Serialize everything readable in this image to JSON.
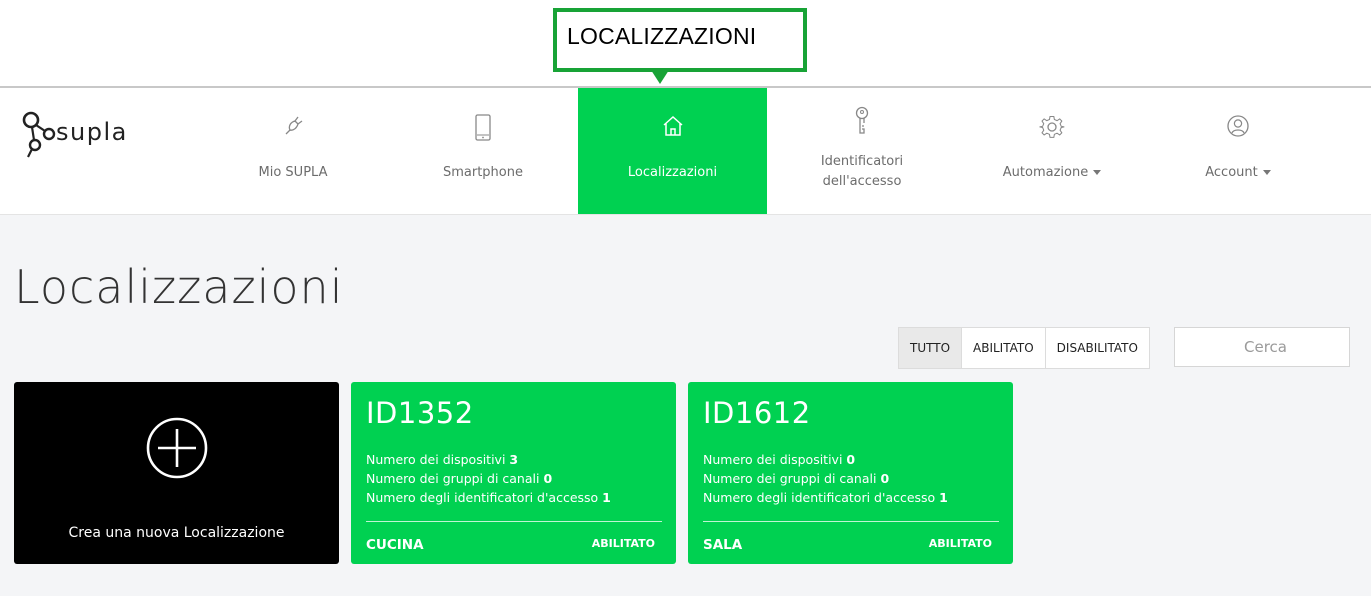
{
  "callout": {
    "text": "LOCALIZZAZIONI",
    "border_color": "#18a336"
  },
  "logo": {
    "text": "supla"
  },
  "nav": {
    "mio_supla": "Mio SUPLA",
    "smartphone": "Smartphone",
    "localizzazioni": "Localizzazioni",
    "access_line1": "Identificatori",
    "access_line2": "dell'accesso",
    "automazione": "Automazione",
    "account": "Account",
    "active_color": "#00d151"
  },
  "page": {
    "title": "Localizzazioni"
  },
  "filters": {
    "all": "TUTTO",
    "enabled": "ABILITATO",
    "disabled": "DISABILITATO",
    "selected": "TUTTO"
  },
  "search": {
    "placeholder": "Cerca",
    "value": ""
  },
  "new_card": {
    "label": "Crea una nuova Localizzazione"
  },
  "stat_labels": {
    "devices": "Numero dei dispositivi",
    "channel_groups": "Numero dei gruppi di canali",
    "access_ids": "Numero degli identificatori d'accesso"
  },
  "locations": [
    {
      "id": "ID1352",
      "devices": "3",
      "channel_groups": "0",
      "access_ids": "1",
      "name": "CUCINA",
      "status": "ABILITATO"
    },
    {
      "id": "ID1612",
      "devices": "0",
      "channel_groups": "0",
      "access_ids": "1",
      "name": "SALA",
      "status": "ABILITATO"
    }
  ]
}
